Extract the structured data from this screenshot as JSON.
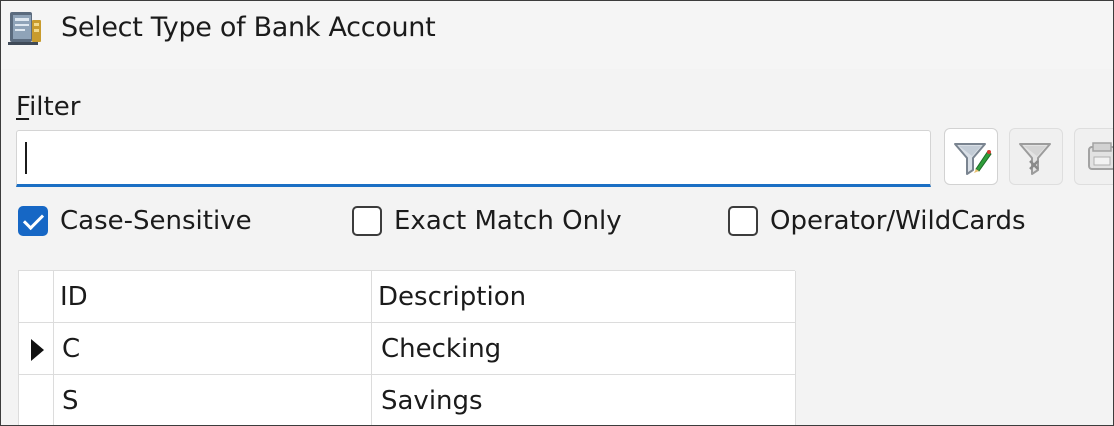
{
  "window": {
    "title": "Select Type of Bank Account",
    "icon": "bank-account-book-icon"
  },
  "filter": {
    "label_accel": "F",
    "label_rest": "ilter",
    "value": "",
    "placeholder": "",
    "buttons": [
      {
        "name": "apply-filter-icon",
        "enabled": true
      },
      {
        "name": "clear-filter-icon",
        "enabled": false
      },
      {
        "name": "filter-options-icon",
        "enabled": false
      }
    ]
  },
  "options": {
    "case_sensitive": {
      "label": "Case-Sensitive",
      "checked": true
    },
    "exact_match": {
      "label": "Exact Match Only",
      "checked": false
    },
    "operator_wildcards": {
      "label": "Operator/WildCards",
      "checked": false
    }
  },
  "table": {
    "columns": [
      "ID",
      "Description"
    ],
    "rows": [
      {
        "id": "C",
        "description": "Checking",
        "current": true
      },
      {
        "id": "S",
        "description": "Savings",
        "current": false
      }
    ]
  },
  "colors": {
    "accent": "#1667c5",
    "focus_underline": "#1b6fc4"
  }
}
